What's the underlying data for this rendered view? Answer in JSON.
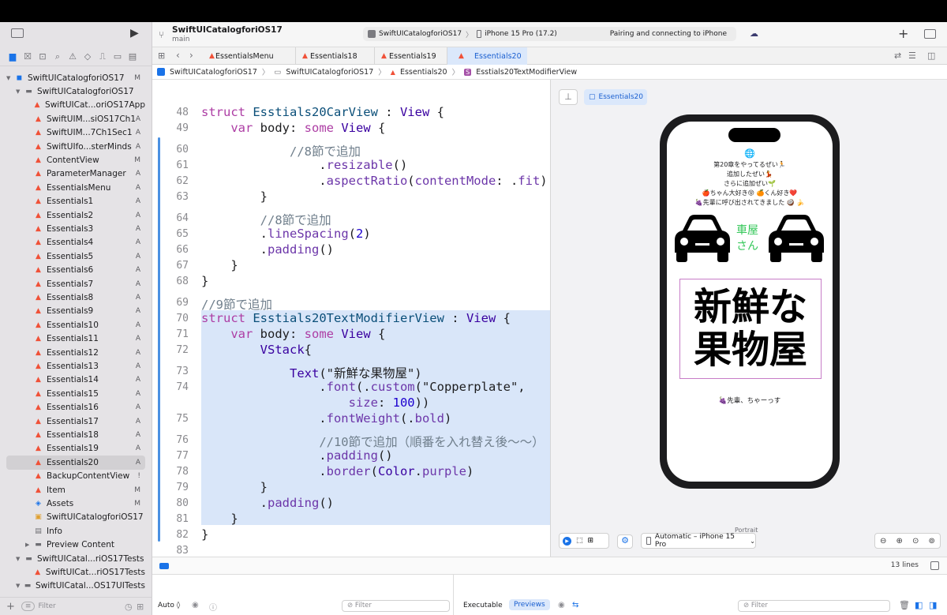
{
  "project": {
    "name": "SwiftUICatalogforiOS17",
    "branch": "main"
  },
  "scheme": {
    "target": "SwiftUICatalogforiOS17",
    "device": "iPhone 15 Pro (17.2)",
    "status": "Pairing and connecting to iPhone"
  },
  "tabs": [
    "EssentialsMenu",
    "Essentials18",
    "Essentials19",
    "Essentials20"
  ],
  "breadcrumb": [
    "SwiftUICatalogforiOS17",
    "SwiftUICatalogforiOS17",
    "Essentials20",
    "Esstials20TextModifierView"
  ],
  "tree": [
    {
      "label": "SwiftUICatalogforiOS17",
      "badge": "M",
      "level": 0,
      "icon": "app",
      "disclosure": "open"
    },
    {
      "label": "SwiftUICatalogforiOS17",
      "badge": "",
      "level": 1,
      "icon": "folder",
      "disclosure": "open"
    },
    {
      "label": "SwiftUICat...oriOS17App",
      "badge": "",
      "level": 2,
      "icon": "swift"
    },
    {
      "label": "SwiftUIM...siOS17Ch1",
      "badge": "A",
      "level": 2,
      "icon": "swift"
    },
    {
      "label": "SwiftUIM...7Ch1Sec1",
      "badge": "A",
      "level": 2,
      "icon": "swift"
    },
    {
      "label": "SwiftUIfo...sterMinds",
      "badge": "A",
      "level": 2,
      "icon": "swift"
    },
    {
      "label": "ContentView",
      "badge": "M",
      "level": 2,
      "icon": "swift"
    },
    {
      "label": "ParameterManager",
      "badge": "A",
      "level": 2,
      "icon": "swift"
    },
    {
      "label": "EssentialsMenu",
      "badge": "A",
      "level": 2,
      "icon": "swift"
    },
    {
      "label": "Essentials1",
      "badge": "A",
      "level": 2,
      "icon": "swift"
    },
    {
      "label": "Essentials2",
      "badge": "A",
      "level": 2,
      "icon": "swift"
    },
    {
      "label": "Essentials3",
      "badge": "A",
      "level": 2,
      "icon": "swift"
    },
    {
      "label": "Essentials4",
      "badge": "A",
      "level": 2,
      "icon": "swift"
    },
    {
      "label": "Essentials5",
      "badge": "A",
      "level": 2,
      "icon": "swift"
    },
    {
      "label": "Essentials6",
      "badge": "A",
      "level": 2,
      "icon": "swift"
    },
    {
      "label": "Essentials7",
      "badge": "A",
      "level": 2,
      "icon": "swift"
    },
    {
      "label": "Essentials8",
      "badge": "A",
      "level": 2,
      "icon": "swift"
    },
    {
      "label": "Essentials9",
      "badge": "A",
      "level": 2,
      "icon": "swift"
    },
    {
      "label": "Essentials10",
      "badge": "A",
      "level": 2,
      "icon": "swift"
    },
    {
      "label": "Essentials11",
      "badge": "A",
      "level": 2,
      "icon": "swift"
    },
    {
      "label": "Essentials12",
      "badge": "A",
      "level": 2,
      "icon": "swift"
    },
    {
      "label": "Essentials13",
      "badge": "A",
      "level": 2,
      "icon": "swift"
    },
    {
      "label": "Essentials14",
      "badge": "A",
      "level": 2,
      "icon": "swift"
    },
    {
      "label": "Essentials15",
      "badge": "A",
      "level": 2,
      "icon": "swift"
    },
    {
      "label": "Essentials16",
      "badge": "A",
      "level": 2,
      "icon": "swift"
    },
    {
      "label": "Essentials17",
      "badge": "A",
      "level": 2,
      "icon": "swift"
    },
    {
      "label": "Essentials18",
      "badge": "A",
      "level": 2,
      "icon": "swift"
    },
    {
      "label": "Essentials19",
      "badge": "A",
      "level": 2,
      "icon": "swift"
    },
    {
      "label": "Essentials20",
      "badge": "A",
      "level": 2,
      "icon": "swift",
      "selected": true
    },
    {
      "label": "BackupContentView",
      "badge": "!",
      "level": 2,
      "icon": "swift"
    },
    {
      "label": "Item",
      "badge": "M",
      "level": 2,
      "icon": "swift"
    },
    {
      "label": "Assets",
      "badge": "M",
      "level": 2,
      "icon": "assets"
    },
    {
      "label": "SwiftUICatalogforiOS17",
      "badge": "",
      "level": 2,
      "icon": "entitlements"
    },
    {
      "label": "Info",
      "badge": "",
      "level": 2,
      "icon": "plist"
    },
    {
      "label": "Preview Content",
      "badge": "",
      "level": 2,
      "icon": "folder",
      "disclosure": "closed"
    },
    {
      "label": "SwiftUICatal...riOS17Tests",
      "badge": "",
      "level": 1,
      "icon": "folder",
      "disclosure": "open"
    },
    {
      "label": "SwiftUICat...riOS17Tests",
      "badge": "",
      "level": 2,
      "icon": "swift"
    },
    {
      "label": "SwiftUICatal...OS17UITests",
      "badge": "",
      "level": 1,
      "icon": "folder",
      "disclosure": "open"
    }
  ],
  "sidebar_filter": "Filter",
  "code": [
    {
      "n": "48",
      "tokens": [
        [
          "kw",
          "struct "
        ],
        [
          "tn",
          "Esstials20CarView"
        ],
        [
          "pl",
          " : "
        ],
        [
          "ty",
          "View"
        ],
        [
          "pl",
          " {"
        ]
      ]
    },
    {
      "n": "49",
      "tokens": [
        [
          "pl",
          "    "
        ],
        [
          "kw",
          "var "
        ],
        [
          "pl",
          "body: "
        ],
        [
          "kw",
          "some "
        ],
        [
          "ty",
          "View"
        ],
        [
          "pl",
          " {"
        ]
      ]
    },
    {
      "n": "60",
      "tokens": [
        [
          "pl",
          "            "
        ],
        [
          "cm",
          "//8節で追加"
        ]
      ]
    },
    {
      "n": "61",
      "tokens": [
        [
          "pl",
          "                ."
        ],
        [
          "fn",
          "resizable"
        ],
        [
          "pl",
          "()"
        ]
      ]
    },
    {
      "n": "62",
      "tokens": [
        [
          "pl",
          "                ."
        ],
        [
          "fn",
          "aspectRatio"
        ],
        [
          "pl",
          "("
        ],
        [
          "fn",
          "contentMode"
        ],
        [
          "pl",
          ": ."
        ],
        [
          "fn",
          "fit"
        ],
        [
          "pl",
          ")"
        ]
      ]
    },
    {
      "n": "63",
      "tokens": [
        [
          "pl",
          "        }"
        ]
      ]
    },
    {
      "n": "64",
      "tokens": [
        [
          "pl",
          "        "
        ],
        [
          "cm",
          "//8節で追加"
        ]
      ]
    },
    {
      "n": "65",
      "tokens": [
        [
          "pl",
          "        ."
        ],
        [
          "fn",
          "lineSpacing"
        ],
        [
          "pl",
          "("
        ],
        [
          "nm",
          "2"
        ],
        [
          "pl",
          ")"
        ]
      ]
    },
    {
      "n": "66",
      "tokens": [
        [
          "pl",
          "        ."
        ],
        [
          "fn",
          "padding"
        ],
        [
          "pl",
          "()"
        ]
      ]
    },
    {
      "n": "67",
      "tokens": [
        [
          "pl",
          "    }"
        ]
      ]
    },
    {
      "n": "68",
      "tokens": [
        [
          "pl",
          "}"
        ]
      ]
    },
    {
      "n": "69",
      "tokens": [
        [
          "cm",
          "//9節で追加"
        ]
      ]
    },
    {
      "n": "70",
      "tokens": [
        [
          "kw",
          "struct "
        ],
        [
          "tn",
          "Esstials20TextModifierView"
        ],
        [
          "pl",
          " : "
        ],
        [
          "ty",
          "View"
        ],
        [
          "pl",
          " {"
        ]
      ]
    },
    {
      "n": "71",
      "tokens": [
        [
          "pl",
          "    "
        ],
        [
          "kw",
          "var "
        ],
        [
          "pl",
          "body: "
        ],
        [
          "kw",
          "some "
        ],
        [
          "ty",
          "View"
        ],
        [
          "pl",
          " {"
        ]
      ]
    },
    {
      "n": "72",
      "tokens": [
        [
          "pl",
          "        "
        ],
        [
          "ty",
          "VStack"
        ],
        [
          "pl",
          "{"
        ]
      ]
    },
    {
      "n": "73",
      "tokens": [
        [
          "pl",
          "            "
        ],
        [
          "ty",
          "Text"
        ],
        [
          "pl",
          "(\"新鮮な果物屋\")"
        ]
      ]
    },
    {
      "n": "74",
      "tokens": [
        [
          "pl",
          "                ."
        ],
        [
          "fn",
          "font"
        ],
        [
          "pl",
          "(."
        ],
        [
          "fn",
          "custom"
        ],
        [
          "pl",
          "(\"Copperplate\","
        ]
      ]
    },
    {
      "n": "",
      "tokens": [
        [
          "pl",
          "                    "
        ],
        [
          "fn",
          "size"
        ],
        [
          "pl",
          ": "
        ],
        [
          "nm",
          "100"
        ],
        [
          "pl",
          "))"
        ]
      ]
    },
    {
      "n": "75",
      "tokens": [
        [
          "pl",
          "                ."
        ],
        [
          "fn",
          "fontWeight"
        ],
        [
          "pl",
          "(."
        ],
        [
          "fn",
          "bold"
        ],
        [
          "pl",
          ")"
        ]
      ]
    },
    {
      "n": "76",
      "tokens": [
        [
          "pl",
          "                "
        ],
        [
          "cm",
          "//10節で追加（順番を入れ替え後〜〜）"
        ]
      ]
    },
    {
      "n": "77",
      "tokens": [
        [
          "pl",
          "                ."
        ],
        [
          "fn",
          "padding"
        ],
        [
          "pl",
          "()"
        ]
      ]
    },
    {
      "n": "78",
      "tokens": [
        [
          "pl",
          "                ."
        ],
        [
          "fn",
          "border"
        ],
        [
          "pl",
          "("
        ],
        [
          "ty",
          "Color"
        ],
        [
          "pl",
          "."
        ],
        [
          "fn",
          "purple"
        ],
        [
          "pl",
          ")"
        ]
      ]
    },
    {
      "n": "79",
      "tokens": [
        [
          "pl",
          "        }"
        ]
      ]
    },
    {
      "n": "80",
      "tokens": [
        [
          "pl",
          "        ."
        ],
        [
          "fn",
          "padding"
        ],
        [
          "pl",
          "()"
        ]
      ]
    },
    {
      "n": "81",
      "tokens": [
        [
          "pl",
          "    }"
        ]
      ]
    },
    {
      "n": "82",
      "tokens": [
        [
          "pl",
          "}"
        ]
      ]
    },
    {
      "n": "83",
      "tokens": [
        [
          "pl",
          ""
        ]
      ]
    }
  ],
  "preview": {
    "chip": "Essentials20",
    "lines": [
      "第20章をやってるぜい🏃",
      "追加したぜい💃",
      "さらに追加ぜい🌱",
      "🍎ちゃん大好き😝 🍊くん好き❤️",
      "🍇先輩に呼び出されてきました 🥥 🍌"
    ],
    "sign": "車屋\nさん",
    "sign_line1": "車屋",
    "sign_line2": "さん",
    "big_text_line1": "新鮮な",
    "big_text_line2": "果物屋",
    "footer": "🍇先輩、ちゃーっす",
    "orientation": "Portrait",
    "device_menu": "Automatic – iPhone 15 Pro"
  },
  "status": {
    "lines": "13 lines"
  },
  "debug": {
    "auto": "Auto ◊",
    "filter_placeholder": "Filter",
    "executable": "Executable",
    "previews": "Previews"
  },
  "colors": {
    "accent": "#1a73e8",
    "selection": "#d9e6f9",
    "purple_border": "#c77dc7",
    "green_text": "#34c759"
  }
}
